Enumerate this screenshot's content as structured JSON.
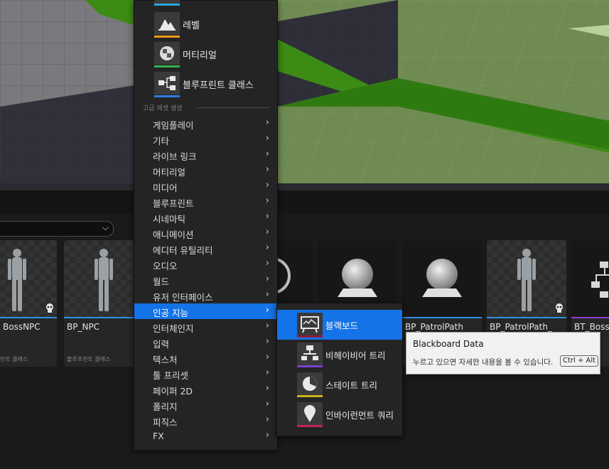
{
  "menu": {
    "top_assets": [
      {
        "label": "레벨",
        "icon": "level-icon",
        "color": "#f39c1d"
      },
      {
        "label": "머티리얼",
        "icon": "material-icon",
        "color": "#34b04a"
      },
      {
        "label": "블루프린트 클래스",
        "icon": "blueprint-class-icon",
        "color": "#2f7de1"
      }
    ],
    "section_header": "고급 에셋 생성",
    "categories": [
      {
        "label": "게임플레이"
      },
      {
        "label": "기타"
      },
      {
        "label": "라이브 링크"
      },
      {
        "label": "머티리얼"
      },
      {
        "label": "미디어"
      },
      {
        "label": "블루프린트"
      },
      {
        "label": "시네마틱"
      },
      {
        "label": "애니메이션"
      },
      {
        "label": "에디터 유틸리티"
      },
      {
        "label": "오디오"
      },
      {
        "label": "월드"
      },
      {
        "label": "유저 인터페이스"
      },
      {
        "label": "인공 지능",
        "active": true
      },
      {
        "label": "인터체인지"
      },
      {
        "label": "입력"
      },
      {
        "label": "텍스처"
      },
      {
        "label": "툴 프리셋"
      },
      {
        "label": "페이퍼 2D"
      },
      {
        "label": "폴리지"
      },
      {
        "label": "피직스"
      },
      {
        "label": "FX"
      }
    ]
  },
  "submenu": {
    "items": [
      {
        "label": "블랙보드",
        "icon": "blackboard-icon",
        "color": "#8b1e3f",
        "active": true
      },
      {
        "label": "비헤이비어 트리",
        "icon": "behavior-tree-icon",
        "color": "#7b3fd0"
      },
      {
        "label": "스테이트 트리",
        "icon": "state-tree-icon",
        "color": "#c9b21f"
      },
      {
        "label": "인바이런먼트 쿼리",
        "icon": "environment-query-icon",
        "color": "#c3245c"
      }
    ]
  },
  "tooltip": {
    "title": "Blackboard Data",
    "hint": "누르고 있으면 자세한 내용을 볼 수 있습니다.",
    "shortcut": "Ctrl + Alt"
  },
  "content_browser": {
    "tiles": [
      {
        "name": "BossNPC",
        "type": "린트 클래스",
        "kind": "character"
      },
      {
        "name": "BP_NPC",
        "type": "블루프린트 클래스",
        "kind": "character"
      },
      {
        "name": "",
        "type": "",
        "kind": "sphere"
      },
      {
        "name": "",
        "type": "",
        "kind": "sphere"
      },
      {
        "name": "BP_PatrolPath",
        "type": "",
        "kind": "sphere"
      },
      {
        "name": "BP_PatrolPath_",
        "type": "",
        "kind": "character"
      },
      {
        "name": "BT_Boss",
        "type": "",
        "kind": "tree"
      }
    ]
  }
}
